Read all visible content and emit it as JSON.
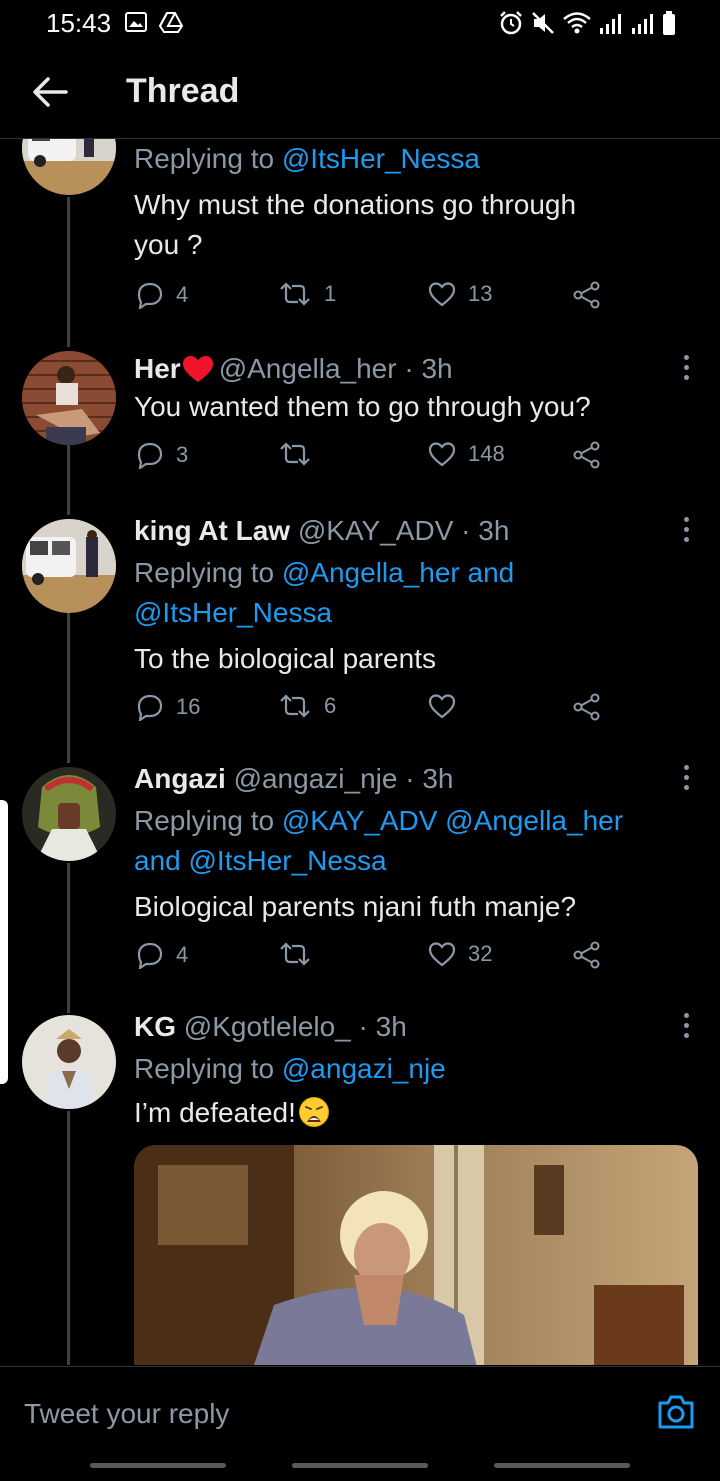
{
  "status_bar": {
    "time": "15:43",
    "left_icons": [
      "gallery-icon",
      "drive-icon"
    ],
    "right_icons": [
      "alarm-icon",
      "mute-icon",
      "wifi-icon",
      "signal-icon",
      "signal-icon",
      "battery-icon"
    ]
  },
  "header": {
    "title": "Thread",
    "back_icon": "arrow-left-icon"
  },
  "tweets": [
    {
      "reply_prefix": "Replying to",
      "mentions": [
        "@ItsHer_Nessa"
      ],
      "text_line1": "Why must the donations go through",
      "text_line2": "you ?",
      "replies": "4",
      "retweets": "1",
      "likes": "13"
    },
    {
      "display_name": "Her",
      "name_emoji": "red-heart-emoji",
      "handle_time": "@Angella_her · 3h",
      "text": "You wanted them to go through you?",
      "replies": "3",
      "retweets": "",
      "likes": "148"
    },
    {
      "display_name": "king At Law",
      "handle_time": "@KAY_ADV · 3h",
      "reply_prefix": "Replying to",
      "mention_1": "@Angella_her and",
      "mention_2": "@ItsHer_Nessa",
      "text": "To the biological parents",
      "replies": "16",
      "retweets": "6",
      "likes": ""
    },
    {
      "display_name": "Angazi",
      "handle_time": "@angazi_nje · 3h",
      "reply_prefix": "Replying to",
      "mention_1": "@KAY_ADV @Angella_her",
      "mention_2": "and @ItsHer_Nessa",
      "text": "Biological parents njani futh manje?",
      "replies": "4",
      "retweets": "",
      "likes": "32"
    },
    {
      "display_name": "KG",
      "handle_time": "@Kgotlelelo_ · 3h",
      "reply_prefix": "Replying to",
      "mention_1": "@angazi_nje",
      "text": "I’m defeated!",
      "text_emoji": "weary-face-emoji",
      "media": "gif-image"
    }
  ],
  "reply_bar": {
    "placeholder": "Tweet your reply",
    "camera_icon": "camera-icon"
  }
}
